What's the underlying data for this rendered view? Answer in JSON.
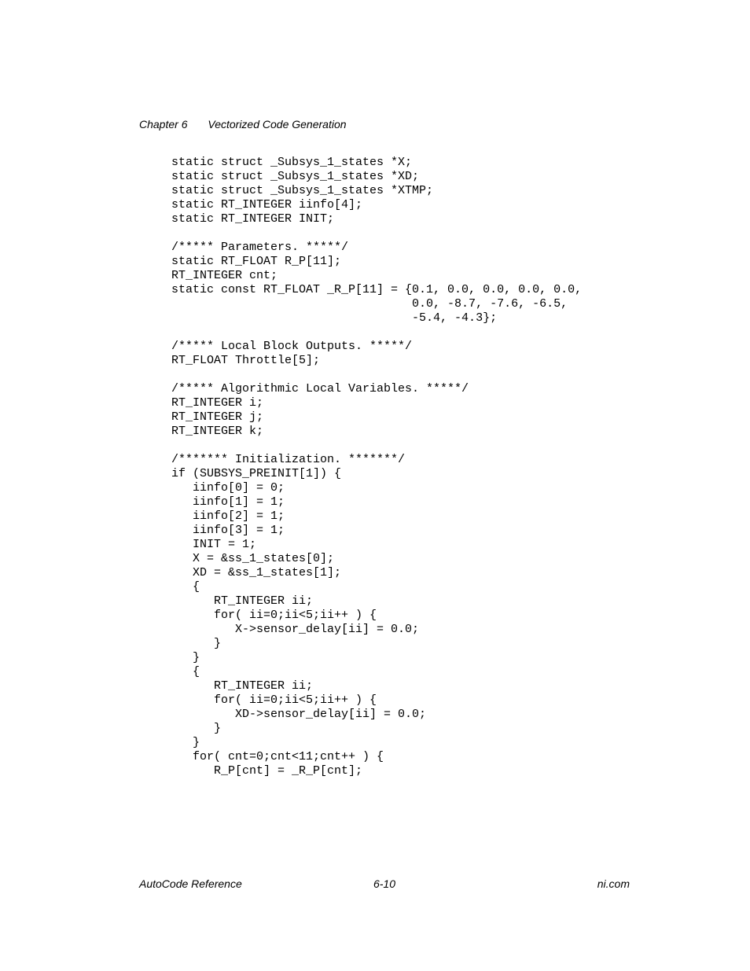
{
  "header": {
    "chapter": "Chapter 6",
    "title": "Vectorized Code Generation"
  },
  "code": "static struct _Subsys_1_states *X;\nstatic struct _Subsys_1_states *XD;\nstatic struct _Subsys_1_states *XTMP;\nstatic RT_INTEGER iinfo[4];\nstatic RT_INTEGER INIT;\n\n/***** Parameters. *****/\nstatic RT_FLOAT R_P[11];\nRT_INTEGER cnt;\nstatic const RT_FLOAT _R_P[11] = {0.1, 0.0, 0.0, 0.0, 0.0,\n                                  0.0, -8.7, -7.6, -6.5,\n                                  -5.4, -4.3};\n\n/***** Local Block Outputs. *****/\nRT_FLOAT Throttle[5];\n\n/***** Algorithmic Local Variables. *****/\nRT_INTEGER i;\nRT_INTEGER j;\nRT_INTEGER k;\n\n/******* Initialization. *******/\nif (SUBSYS_PREINIT[1]) {\n   iinfo[0] = 0;\n   iinfo[1] = 1;\n   iinfo[2] = 1;\n   iinfo[3] = 1;\n   INIT = 1;\n   X = &ss_1_states[0];\n   XD = &ss_1_states[1];\n   {\n      RT_INTEGER ii;\n      for( ii=0;ii<5;ii++ ) {\n         X->sensor_delay[ii] = 0.0;\n      }\n   }\n   {\n      RT_INTEGER ii;\n      for( ii=0;ii<5;ii++ ) {\n         XD->sensor_delay[ii] = 0.0;\n      }\n   }\n   for( cnt=0;cnt<11;cnt++ ) {\n      R_P[cnt] = _R_P[cnt];",
  "footer": {
    "left": "AutoCode Reference",
    "center": "6-10",
    "right": "ni.com"
  }
}
